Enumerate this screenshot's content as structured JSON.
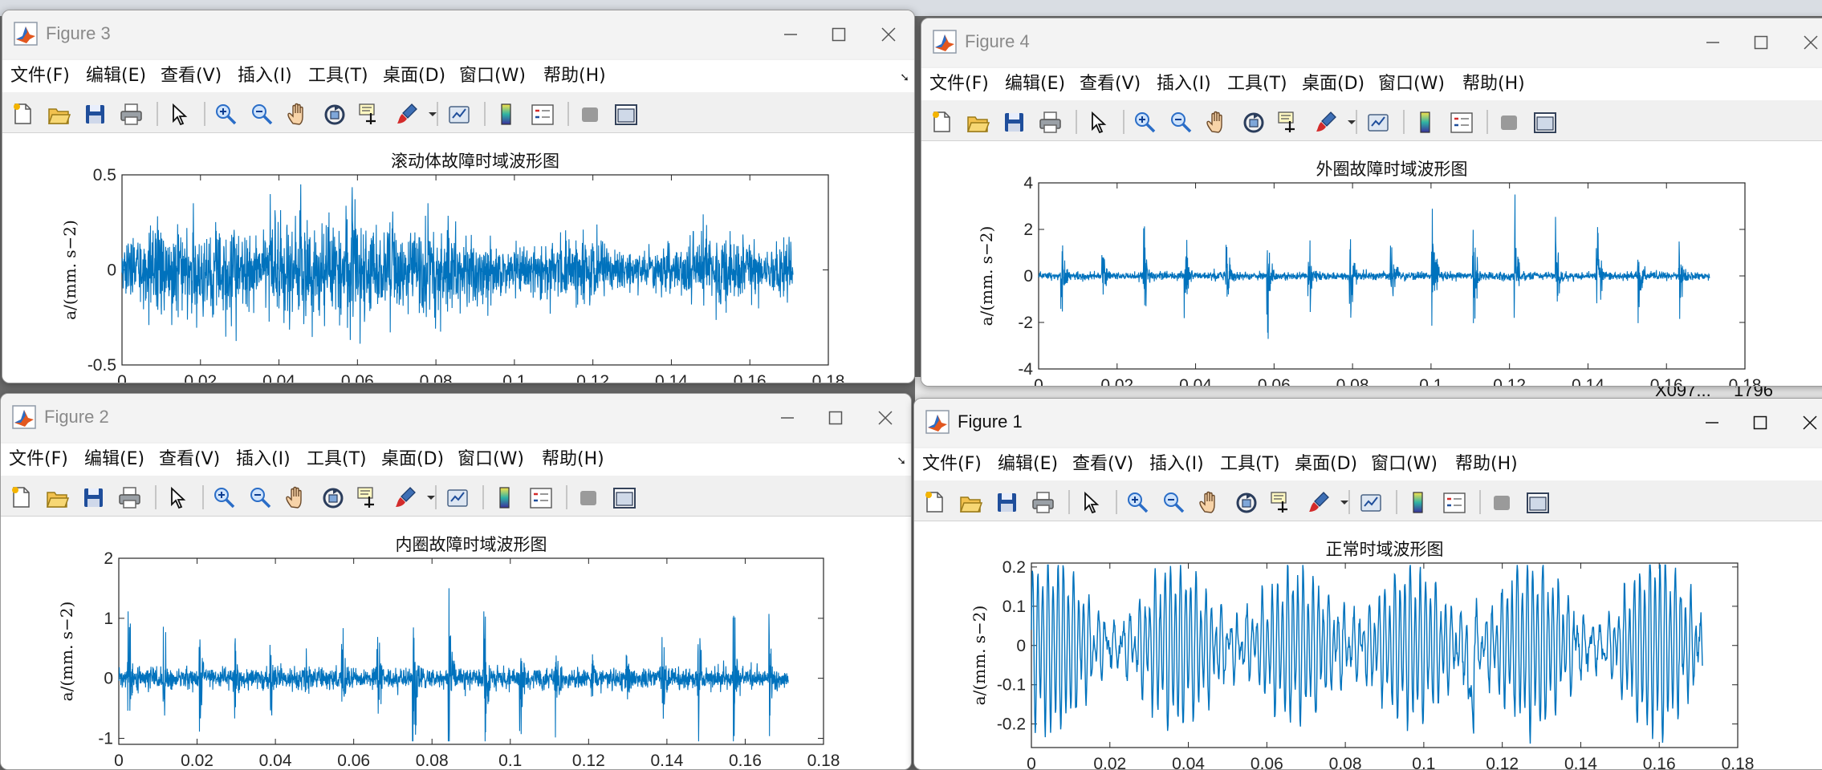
{
  "background": {
    "cell_name": "X097...",
    "cell_value": "1796"
  },
  "menu": [
    "文件(F)",
    "编辑(E)",
    "查看(V)",
    "插入(I)",
    "工具(T)",
    "桌面(D)",
    "窗口(W)",
    "帮助(H)"
  ],
  "colors": {
    "series": "#0072bd",
    "window_bg": "#f0f0f0",
    "plot_bg": "#ffffff"
  },
  "toolbar_icons": [
    "new-figure-icon",
    "open-file-icon",
    "save-icon",
    "print-icon",
    "sep",
    "select-arrow-icon",
    "sep",
    "zoom-in-icon",
    "zoom-out-icon",
    "pan-icon",
    "rotate-3d-icon",
    "data-cursor-icon",
    "brush-icon",
    "sep",
    "link-plot-icon",
    "sep",
    "colorbar-icon",
    "legend-icon",
    "sep",
    "hide-plot-tools-icon",
    "show-plot-tools-icon"
  ],
  "figures": [
    {
      "id": "fig3",
      "title": "Figure 3",
      "active": false,
      "chart_data": {
        "type": "line",
        "title": "滚动体故障时域波形图",
        "xlabel": "",
        "ylabel": "a/(mm. s−2)",
        "xlim": [
          0,
          0.18
        ],
        "ylim": [
          -0.5,
          0.5
        ],
        "xticks": [
          0,
          0.02,
          0.04,
          0.06,
          0.08,
          0.1,
          0.12,
          0.14,
          0.16,
          0.18
        ],
        "yticks": [
          -0.5,
          0,
          0.5
        ],
        "x_range": [
          0,
          0.171
        ],
        "series": [
          {
            "peak_max": 0.45,
            "peak_min": -0.48,
            "typical_amplitude": 0.18,
            "pattern": "dense broadband noise, strongest burst near x=0.063"
          }
        ]
      }
    },
    {
      "id": "fig4",
      "title": "Figure 4",
      "active": false,
      "chart_data": {
        "type": "line",
        "title": "外圈故障时域波形图",
        "xlabel": "",
        "ylabel": "a/(mm. s−2)",
        "xlim": [
          0,
          0.18
        ],
        "ylim": [
          -4,
          4
        ],
        "xticks": [
          0,
          0.02,
          0.04,
          0.06,
          0.08,
          0.1,
          0.12,
          0.14,
          0.16,
          0.18
        ],
        "yticks": [
          -4,
          -2,
          0,
          2,
          4
        ],
        "x_range": [
          0,
          0.171
        ],
        "series": [
          {
            "baseline_amplitude": 0.15,
            "impulse_peak_range": [
              2.0,
              3.5
            ],
            "impulse_times": [
              0.006,
              0.0165,
              0.027,
              0.0375,
              0.048,
              0.0585,
              0.069,
              0.0795,
              0.09,
              0.1005,
              0.111,
              0.1215,
              0.132,
              0.1425,
              0.153,
              0.1635
            ],
            "pattern": "periodic impulses every ~0.0105 s"
          }
        ]
      }
    },
    {
      "id": "fig2",
      "title": "Figure 2",
      "active": false,
      "chart_data": {
        "type": "line",
        "title": "内圈故障时域波形图",
        "xlabel": "",
        "ylabel": "a/(mm. s−2)",
        "xlim": [
          0,
          0.18
        ],
        "ylim": [
          -1.1,
          2
        ],
        "xticks": [
          0,
          0.02,
          0.04,
          0.06,
          0.08,
          0.1,
          0.12,
          0.14,
          0.16,
          0.18
        ],
        "yticks": [
          -1,
          0,
          1,
          2
        ],
        "x_range": [
          0,
          0.171
        ],
        "series": [
          {
            "baseline_amplitude": 0.15,
            "impulse_peak_range": [
              0.8,
              1.5
            ],
            "impulse_period": 0.0091,
            "pattern": "periodic impulses with amplitude modulation"
          }
        ]
      }
    },
    {
      "id": "fig1",
      "title": "Figure 1",
      "active": true,
      "chart_data": {
        "type": "line",
        "title": "正常时域波形图",
        "xlabel": "",
        "ylabel": "a/(mm. s−2)",
        "xlim": [
          0,
          0.18
        ],
        "ylim": [
          -0.26,
          0.21
        ],
        "xticks": [
          0,
          0.02,
          0.04,
          0.06,
          0.08,
          0.1,
          0.12,
          0.14,
          0.16,
          0.18
        ],
        "yticks": [
          -0.2,
          -0.1,
          0,
          0.1,
          0.2
        ],
        "x_range": [
          0,
          0.171
        ],
        "series": [
          {
            "dominant_period": 0.0013,
            "amplitude_range": [
              0.05,
              0.2
            ],
            "min_value": -0.25,
            "pattern": "quasi-sinusoidal oscillation with beating envelope"
          }
        ]
      }
    }
  ]
}
